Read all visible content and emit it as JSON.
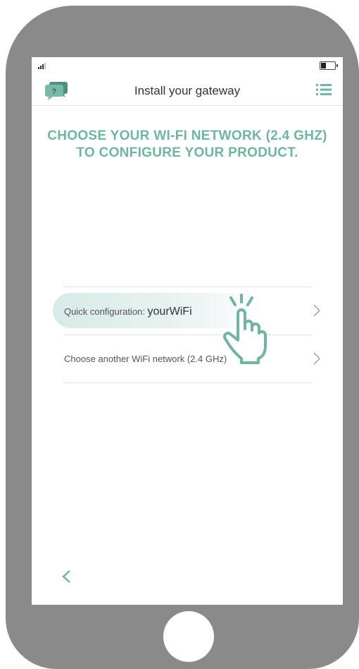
{
  "header": {
    "title": "Install your gateway"
  },
  "main": {
    "headline": "CHOOSE YOUR WI-FI NETWORK (2.4 GHZ) TO CONFIGURE YOUR PRODUCT.",
    "options": [
      {
        "label": "Quick configuration: ",
        "ssid": "yourWiFi"
      },
      {
        "label": "Choose another WiFi network (2.4 GHz)"
      }
    ]
  },
  "colors": {
    "accent": "#6fb5a3",
    "device_frame": "#8a8a8a",
    "highlight": "#cde4e0"
  },
  "icons": [
    "signal-icon",
    "battery-icon",
    "chat-help-icon",
    "menu-list-icon",
    "chevron-right-icon",
    "pointing-hand-icon",
    "back-chevron-icon"
  ]
}
